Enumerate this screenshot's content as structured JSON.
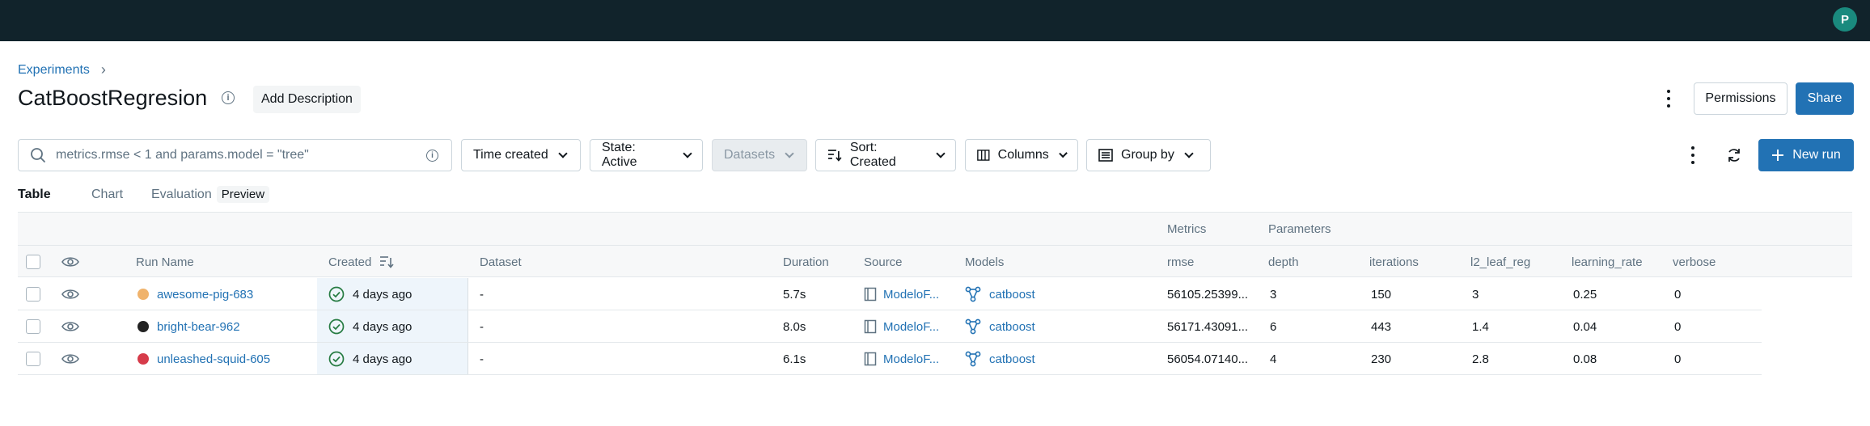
{
  "topbar": {
    "avatar_initial": "P"
  },
  "breadcrumb": {
    "experiments": "Experiments",
    "separator": "›"
  },
  "header": {
    "title": "CatBoostRegresion",
    "add_description": "Add Description",
    "permissions": "Permissions",
    "share": "Share"
  },
  "toolbar": {
    "search_placeholder": "metrics.rmse < 1 and params.model = \"tree\"",
    "time_created": "Time created",
    "state": "State: Active",
    "datasets": "Datasets",
    "sort": "Sort: Created",
    "columns": "Columns",
    "group_by": "Group by",
    "new_run": "New run"
  },
  "tabs": {
    "table": "Table",
    "chart": "Chart",
    "evaluation": "Evaluation",
    "preview": "Preview"
  },
  "table": {
    "groups": {
      "metrics": "Metrics",
      "parameters": "Parameters"
    },
    "headers": {
      "run_name": "Run Name",
      "created": "Created",
      "dataset": "Dataset",
      "duration": "Duration",
      "source": "Source",
      "models": "Models",
      "rmse": "rmse",
      "depth": "depth",
      "iterations": "iterations",
      "l2_leaf_reg": "l2_leaf_reg",
      "learning_rate": "learning_rate",
      "verbose": "verbose"
    },
    "rows": [
      {
        "color": "#f0b36c",
        "run_name": "awesome-pig-683",
        "created": "4 days ago",
        "dataset": "-",
        "duration": "5.7s",
        "source": "ModeloF...",
        "model": "catboost",
        "rmse": "56105.25399...",
        "depth": "3",
        "iterations": "150",
        "l2_leaf_reg": "3",
        "learning_rate": "0.25",
        "verbose": "0"
      },
      {
        "color": "#222222",
        "run_name": "bright-bear-962",
        "created": "4 days ago",
        "dataset": "-",
        "duration": "8.0s",
        "source": "ModeloF...",
        "model": "catboost",
        "rmse": "56171.43091...",
        "depth": "6",
        "iterations": "443",
        "l2_leaf_reg": "1.4",
        "learning_rate": "0.04",
        "verbose": "0"
      },
      {
        "color": "#d63b4a",
        "run_name": "unleashed-squid-605",
        "created": "4 days ago",
        "dataset": "-",
        "duration": "6.1s",
        "source": "ModeloF...",
        "model": "catboost",
        "rmse": "56054.07140...",
        "depth": "4",
        "iterations": "230",
        "l2_leaf_reg": "2.8",
        "learning_rate": "0.08",
        "verbose": "0"
      }
    ]
  },
  "colors": {
    "accent": "#2272b4",
    "topbar": "#11232b",
    "avatar": "#1a8a7e",
    "success": "#277c43"
  }
}
